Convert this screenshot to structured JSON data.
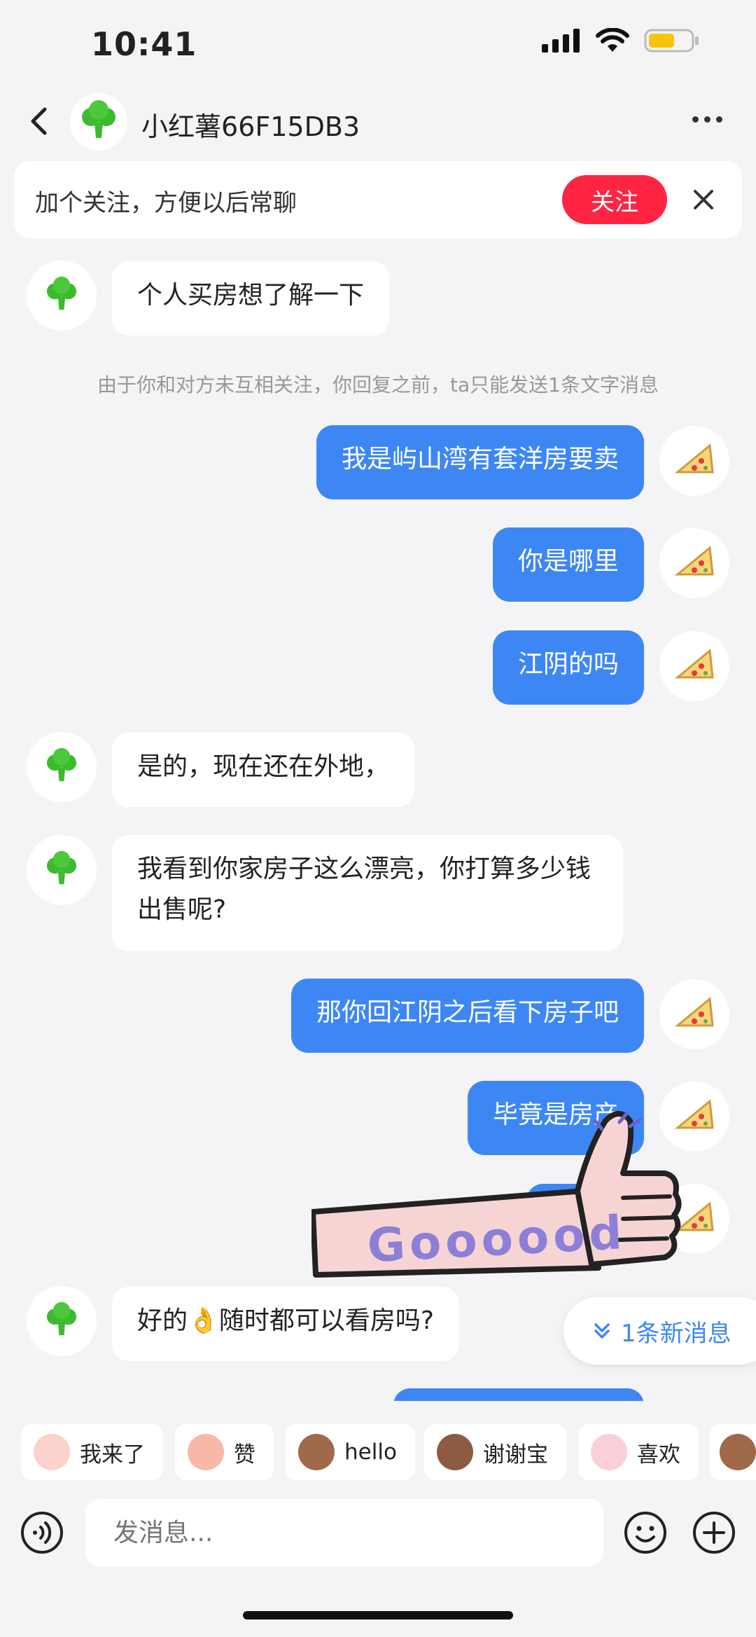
{
  "status": {
    "time": "10:41"
  },
  "header": {
    "title": "小红薯66F15DB3"
  },
  "banner": {
    "text": "加个关注，方便以后常聊",
    "follow_label": "关注"
  },
  "notice": "由于你和对方未互相关注，你回复之前，ta只能发送1条文字消息",
  "messages": [
    {
      "side": "in",
      "text": "个人买房想了解一下"
    },
    {
      "side": "out",
      "text": "我是屿山湾有套洋房要卖"
    },
    {
      "side": "out",
      "text": "你是哪里"
    },
    {
      "side": "out",
      "text": "江阴的吗"
    },
    {
      "side": "in",
      "text": "是的，现在还在外地，"
    },
    {
      "side": "in",
      "text": "我看到你家房子这么漂亮，你打算多少钱出售呢?"
    },
    {
      "side": "out",
      "text": "那你回江阴之后看下房子吧"
    },
    {
      "side": "out",
      "text": "毕竟是房产"
    },
    {
      "side": "in",
      "text": "好的👌随时都可以看房吗?"
    }
  ],
  "sticker_text": "Goooood",
  "new_message_pill": "1条新消息",
  "quick_stickers": [
    {
      "label": "我来了"
    },
    {
      "label": "赞"
    },
    {
      "label": "hello"
    },
    {
      "label": "谢谢宝"
    },
    {
      "label": "喜欢"
    }
  ],
  "composer": {
    "placeholder": "发消息..."
  },
  "colors": {
    "accent": "#ff2442",
    "bubble_out": "#3d87f5",
    "bubble_in": "#ffffff"
  }
}
